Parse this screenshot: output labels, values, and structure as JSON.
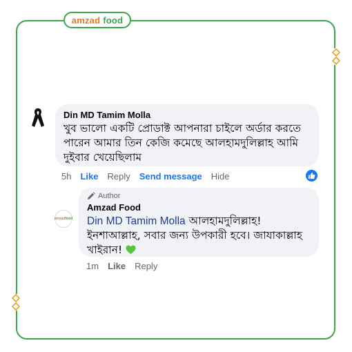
{
  "brand": {
    "part1": "amzad",
    "part2": "food"
  },
  "comment": {
    "author": "Din MD Tamim Molla",
    "text": "খুব ভালো একটি প্রোডাক্ট আপনারা চাইলে অর্ডার করতে পারেন আমার তিন কেজি কমেছে আলহামদুলিল্লাহ আমি দুইবার খেয়েছিলাম",
    "time": "5h",
    "like_label": "Like",
    "reply_label": "Reply",
    "send_label": "Send message",
    "hide_label": "Hide",
    "reaction_icon": "like-reaction-icon"
  },
  "reply": {
    "badge": "Author",
    "author": "Amzad Food",
    "mention": "Din MD Tamim Molla",
    "text": "আলহামদুলিল্লাহ! ইনশাআল্লাহ, সবার জন্য উপকারী হবে। জাযাকাল্লাহ খাইরান!",
    "time": "1m",
    "like_label": "Like",
    "reply_label": "Reply",
    "emoji": "green-heart"
  },
  "colors": {
    "frame": "#39a64a",
    "brand_orange": "#e07b1b",
    "link_blue": "#1877f2",
    "bubble": "#f0f2f5"
  }
}
